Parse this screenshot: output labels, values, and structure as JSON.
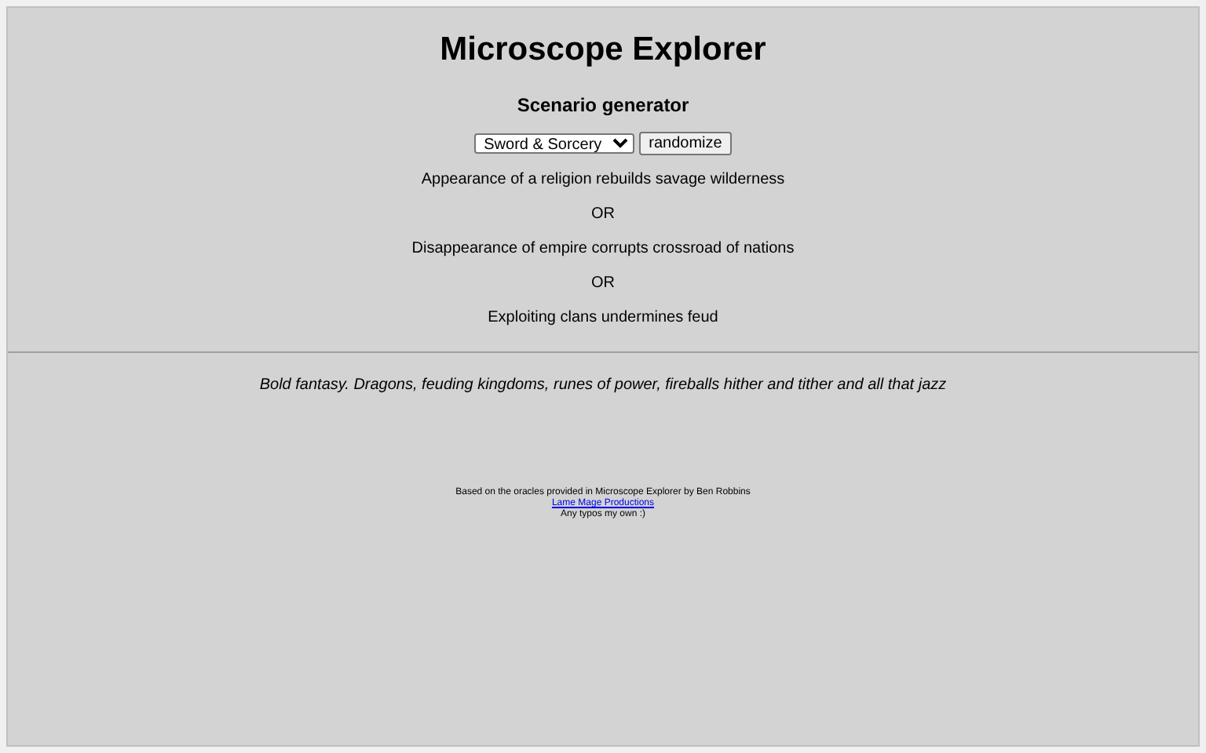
{
  "title": "Microscope Explorer",
  "subtitle": "Scenario generator",
  "genre_select": {
    "value": "Sword & Sorcery"
  },
  "randomize_button": "randomize",
  "results": [
    "Appearance of a religion rebuilds savage wilderness",
    "OR",
    "Disappearance of empire corrupts crossroad of nations",
    "OR",
    "Exploiting clans undermines feud"
  ],
  "description": "Bold fantasy. Dragons, feuding kingdoms, runes of power, fireballs hither and tither and all that jazz",
  "footer": {
    "credit": "Based on the oracles provided in Microscope Explorer by Ben Robbins",
    "link": "Lame Mage Productions",
    "note": "Any typos my own :)"
  }
}
